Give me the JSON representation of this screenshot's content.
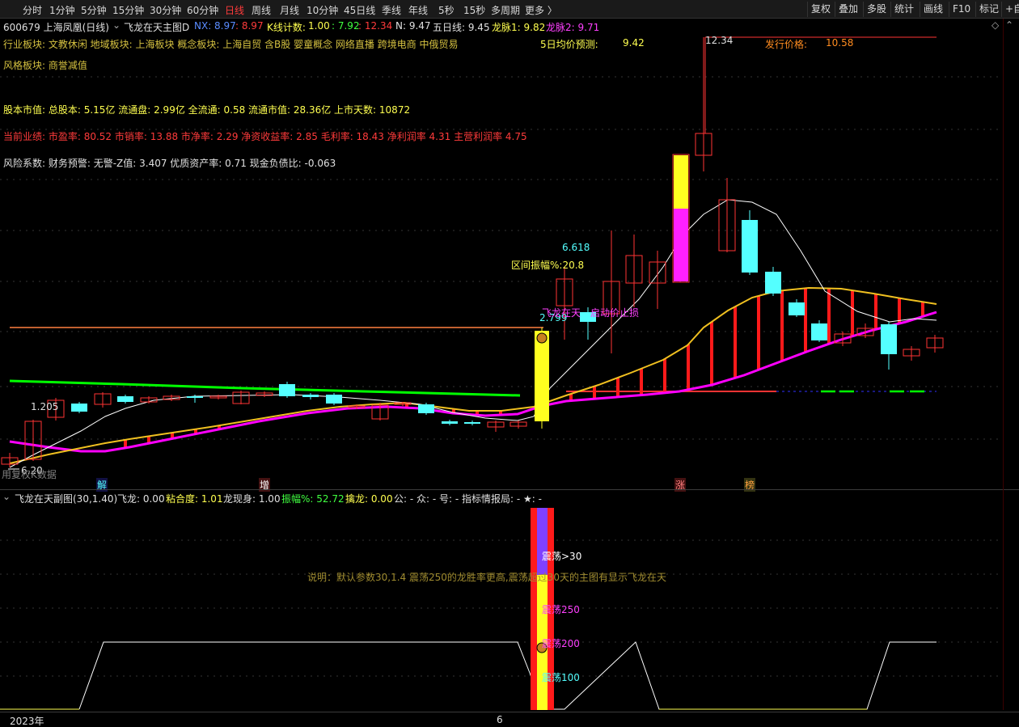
{
  "toolbar": {
    "periods": [
      "分时",
      "1分钟",
      "5分钟",
      "15分钟",
      "30分钟",
      "60分钟",
      "日线",
      "周线",
      "月线",
      "10分钟",
      "45日线",
      "季线",
      "年线",
      "5秒",
      "15秒",
      "多周期",
      "更多 〉"
    ],
    "active_period": "日线",
    "right_buttons": [
      "复权",
      "叠加",
      "多股",
      "统计",
      "画线",
      "F10",
      "标记",
      "+自"
    ]
  },
  "header": {
    "code_name": "600679 上海凤凰(日线)",
    "indicator_name": "飞龙在天主图D",
    "nx_label": "NX: ",
    "nx_value1": "8.97",
    "nx_value2": ": 8.97",
    "kline_label": "K线计数: ",
    "kline_value": "1.00",
    "v1": ": 7.92",
    "v2": ": 12.34",
    "n_label": "N: 9.47",
    "wuri_label": "五日线: 9.45",
    "longmai1": "龙脉1: 9.82",
    "longmai2": "龙脉2: 9.71"
  },
  "info": {
    "sector_line": "行业板块:   文教休闲      地域板块:   上海板块      概念板块:   上海自贸  含B股  婴童概念  网络直播  跨境电商  中俄贸易",
    "style_line": "风格板块:   商誉减值",
    "equity_line": "股本市值: 总股本: 5.15亿 流通盘: 2.99亿 全流通: 0.58 流通市值: 28.36亿 上市天数: 10872",
    "perf_line": "当前业绩: 市盈率: 80.52 市销率: 13.88 市净率: 2.29 净资收益率: 2.85 毛利率: 18.43 净利润率 4.31 主营利润率 4.75",
    "risk_line": "风险系数: 财务预警: 无警-Z值: 3.407 优质资产率: 0.71 现金负债比: -0.063",
    "forecast_label": "5日均价预测:",
    "forecast_value": "9.42",
    "issue_label": "发行价格:",
    "issue_value": "10.58"
  },
  "main_chart": {
    "label_high": "12.34",
    "label_6618": "6.618",
    "label_range": "区间振幅%:20.8",
    "label_2799": "2.799",
    "label_1205": "1.205",
    "label_low": "6.20",
    "label_feilong": "飞龙在天",
    "label_stoploss": "启动价止损",
    "label_sub": "用复权K数据",
    "mark_jie": "解",
    "mark_zeng": "增",
    "mark_zhang": "涨",
    "mark_bang": "榜"
  },
  "sub_header": {
    "title": "飞龙在天副图(30,1.40)",
    "feilong": "飞龙: 0.00",
    "nianhe": "粘合度: 1.01",
    "longxian": "龙现身: 1.00",
    "zhenfu": "振幅%: 52.72",
    "qinlong": "擒龙: 0.00",
    "rest": "公: -  众: -  号: -  指标情报局: -  ★: -"
  },
  "sub_chart": {
    "explain": "说明：默认参数30,1.4 震荡250的龙胜率更高,震荡超过30天的主图有显示飞龙在天",
    "z30": "震荡>30",
    "z250": "震荡250",
    "z200": "震荡200",
    "z100": "震荡100"
  },
  "xaxis": {
    "year": "2023年",
    "month": "6"
  },
  "colors": {
    "up": "#ff3333",
    "down": "#54ffff",
    "ma_white": "#ffffff",
    "ma_yellow": "#f0c020",
    "ma_magenta": "#ff00ff",
    "ma_green": "#00ff00"
  }
}
